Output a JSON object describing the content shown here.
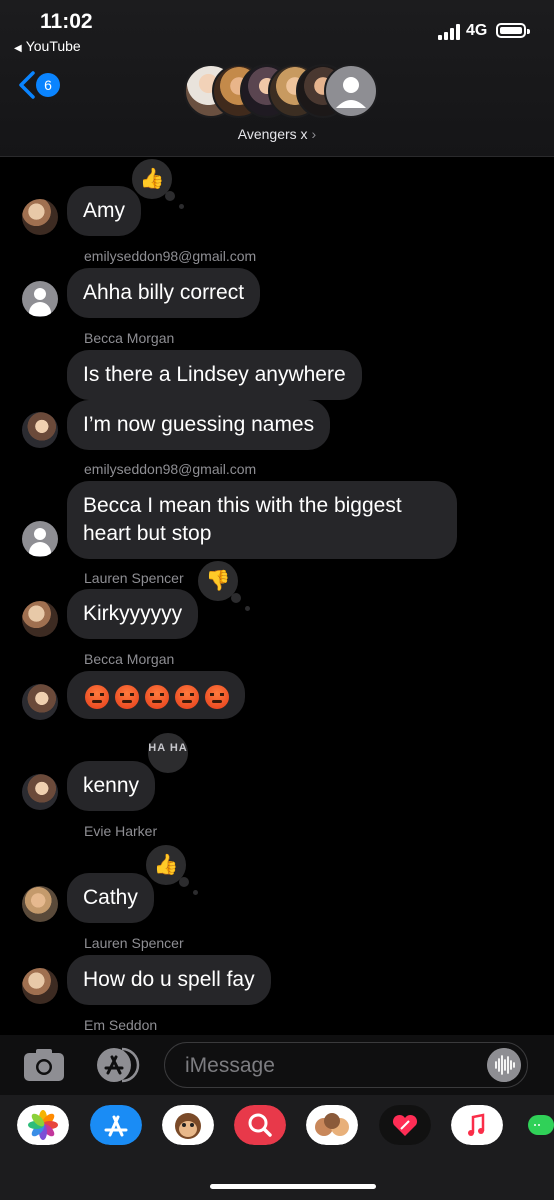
{
  "status_bar": {
    "time": "11:02",
    "back_app": "YouTube",
    "network": "4G"
  },
  "header": {
    "unread_count": "6",
    "group_name": "Avengers x",
    "chevron": "›"
  },
  "messages": [
    {
      "sender": "",
      "text": "Amy",
      "tapback": "thumbs-up"
    },
    {
      "sender": "emilyseddon98@gmail.com",
      "text": "Ahha billy correct"
    },
    {
      "sender": "Becca Morgan",
      "text": "Is there a Lindsey anywhere"
    },
    {
      "sender": "",
      "text": "I’m now guessing names"
    },
    {
      "sender": "emilyseddon98@gmail.com",
      "text": "Becca I mean this with the biggest heart but stop"
    },
    {
      "sender": "Lauren Spencer",
      "text": "Kirkyyyyyy",
      "tapback": "thumbs-down"
    },
    {
      "sender": "Becca Morgan",
      "emoji": "pouting-face",
      "emoji_count": 5
    },
    {
      "sender": "",
      "text": "kenny",
      "tapback": "haha",
      "tapback_text": "HA HA"
    },
    {
      "sender": "Evie Harker",
      "text": ""
    },
    {
      "sender": "",
      "text": "Cathy",
      "tapback": "thumbs-up"
    },
    {
      "sender": "Lauren Spencer",
      "text": ""
    },
    {
      "sender": "",
      "text": "How do u spell fay"
    },
    {
      "sender": "Em Seddon",
      "text": ""
    }
  ],
  "composer": {
    "placeholder": "iMessage"
  },
  "app_drawer": {
    "icons": [
      "photos-icon",
      "app-store-icon",
      "monkey-memoji-icon",
      "search-images-icon",
      "memoji-stickers-icon",
      "digital-touch-icon",
      "music-icon",
      "more-icon"
    ]
  },
  "colors": {
    "accent": "#0a84ff",
    "bubble": "#262629",
    "background": "#000000"
  }
}
